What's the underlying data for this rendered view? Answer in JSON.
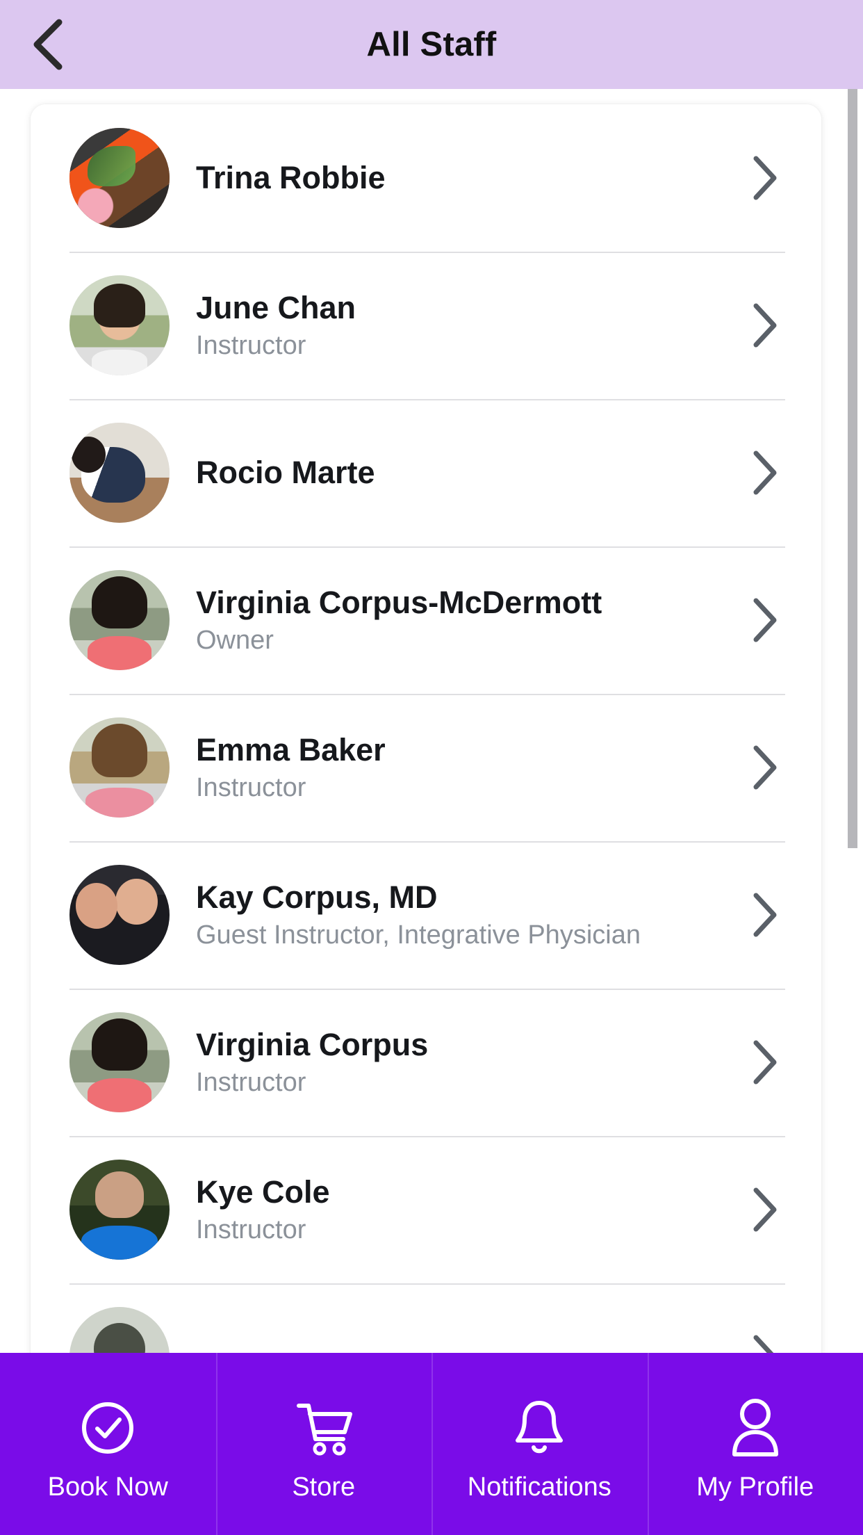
{
  "header": {
    "title": "All Staff",
    "back_icon": "chevron-left-icon",
    "background_color": "#dcc7f0"
  },
  "theme": {
    "header_purple": "#dcc7f0",
    "nav_purple": "#7a0ce8",
    "name_color": "#16181c",
    "role_color": "#8b9199",
    "divider_color": "#dfdfe2",
    "chevron_color": "#5a6068"
  },
  "staff_list": [
    {
      "name": "Trina Robbie",
      "role": "",
      "avatar": "avatar-trina-robbie",
      "chevron": "chevron-right-icon"
    },
    {
      "name": "June Chan",
      "role": "Instructor",
      "avatar": "avatar-june-chan",
      "chevron": "chevron-right-icon"
    },
    {
      "name": "Rocio Marte",
      "role": "",
      "avatar": "avatar-rocio-marte",
      "chevron": "chevron-right-icon"
    },
    {
      "name": "Virginia Corpus-McDermott",
      "role": "Owner",
      "avatar": "avatar-virginia-corpus-mcdermott",
      "chevron": "chevron-right-icon"
    },
    {
      "name": "Emma Baker",
      "role": "Instructor",
      "avatar": "avatar-emma-baker",
      "chevron": "chevron-right-icon"
    },
    {
      "name": "Kay Corpus, MD",
      "role": "Guest Instructor, Integrative Physician",
      "avatar": "avatar-kay-corpus",
      "chevron": "chevron-right-icon"
    },
    {
      "name": "Virginia Corpus",
      "role": "Instructor",
      "avatar": "avatar-virginia-corpus",
      "chevron": "chevron-right-icon"
    },
    {
      "name": "Kye Cole",
      "role": "Instructor",
      "avatar": "avatar-kye-cole",
      "chevron": "chevron-right-icon"
    },
    {
      "name": "",
      "role": "",
      "avatar": "avatar-next-staff",
      "chevron": "chevron-right-icon"
    }
  ],
  "bottom_nav": {
    "items": [
      {
        "label": "Book Now",
        "icon": "check-circle-icon"
      },
      {
        "label": "Store",
        "icon": "shopping-cart-icon"
      },
      {
        "label": "Notifications",
        "icon": "bell-icon"
      },
      {
        "label": "My Profile",
        "icon": "person-icon"
      }
    ]
  },
  "scrollbar": {
    "visible": true
  }
}
